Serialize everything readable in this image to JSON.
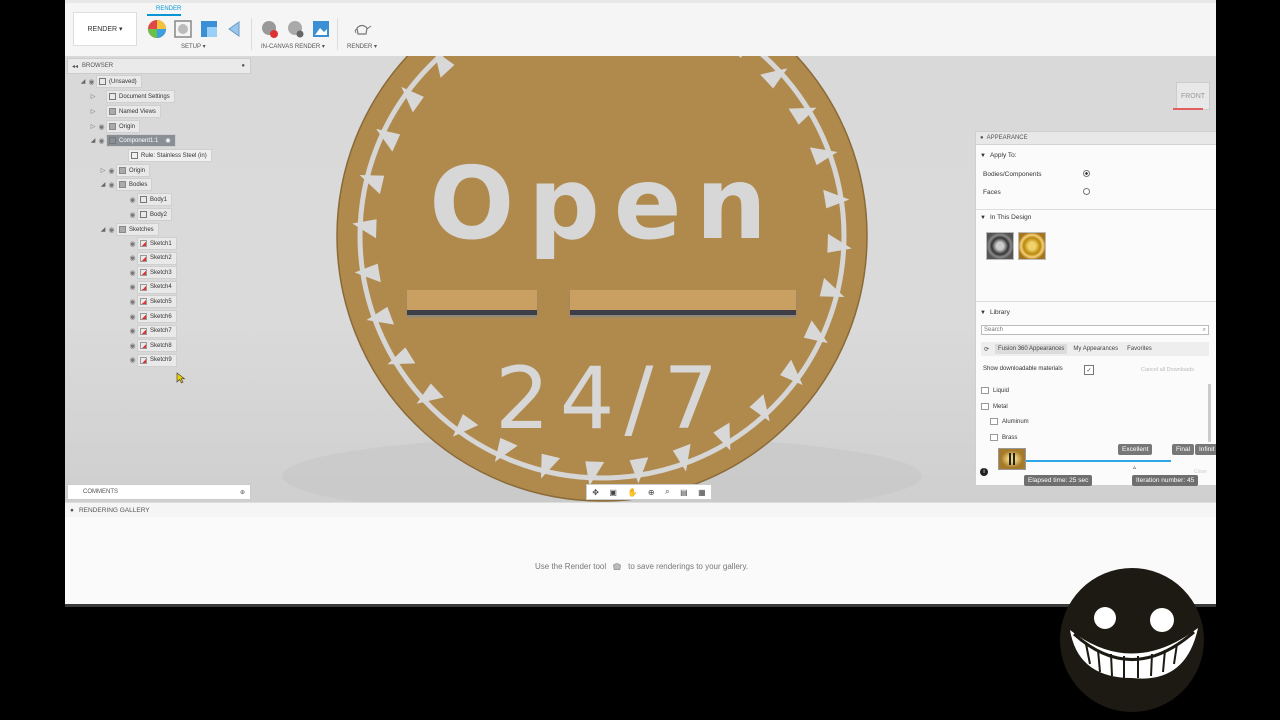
{
  "toolbar": {
    "workspace": "RENDER ▾",
    "tab": "RENDER",
    "groups": [
      "SETUP ▾",
      "IN-CANVAS RENDER ▾",
      "RENDER ▾"
    ]
  },
  "browser": {
    "title": "BROWSER",
    "root": "(Unsaved)",
    "items": [
      "Document Settings",
      "Named Views",
      "Origin",
      "Component1:1",
      "Rule: Stainless Steel (in)",
      "Origin",
      "Bodies",
      "Body1",
      "Body2",
      "Sketches",
      "Sketch1",
      "Sketch2",
      "Sketch3",
      "Sketch4",
      "Sketch5",
      "Sketch6",
      "Sketch7",
      "Sketch8",
      "Sketch9"
    ]
  },
  "comments": {
    "title": "COMMENTS"
  },
  "viewcube": {
    "label": "FRONT"
  },
  "sign": {
    "line1": "Open",
    "line2": "24/7"
  },
  "appearance": {
    "title": "APPEARANCE",
    "apply_to": "Apply To:",
    "opt_bodies": "Bodies/Components",
    "opt_faces": "Faces",
    "in_design": "In This Design",
    "library": "Library",
    "search_placeholder": "Search",
    "tabs": [
      "Fusion 360 Appearances",
      "My Appearances",
      "Favorites"
    ],
    "show_downloadable": "Show downloadable materials",
    "cancel_downloads": "Cancel all Downloads",
    "folders": [
      "Liquid",
      "Metal",
      "Aluminum",
      "Brass"
    ]
  },
  "render_status": {
    "quality": [
      "Excellent",
      "Final",
      "Infinit"
    ],
    "elapsed": "Elapsed time: 25 sec",
    "iteration": "Iteration number: 45",
    "close": "Close"
  },
  "gallery": {
    "title": "RENDERING GALLERY",
    "msg_before": "Use the Render tool",
    "msg_after": "to save renderings to your gallery."
  },
  "colors": {
    "accent": "#0696d7",
    "sign": "#b08a4d",
    "selected": "#8a8f95"
  }
}
